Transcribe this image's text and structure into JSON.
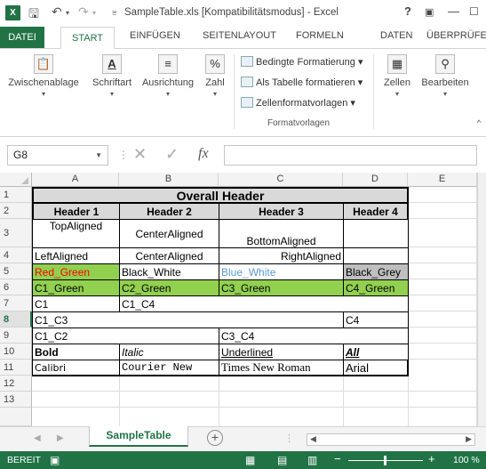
{
  "titlebar": {
    "app_icon": "X",
    "title": "SampleTable.xls [Kompatibilitätsmodus] - Excel",
    "help": "?"
  },
  "tabs": [
    "DATEI",
    "START",
    "EINFÜGEN",
    "SEITENLAYOUT",
    "FORMELN",
    "DATEN",
    "ÜBERPRÜFEN"
  ],
  "active_tab": "START",
  "ribbon": {
    "clipboard": "Zwischenablage",
    "font": "Schriftart",
    "alignment": "Ausrichtung",
    "number": "Zahl",
    "cond_format": "Bedingte Formatierung ▾",
    "table_format": "Als Tabelle formatieren ▾",
    "cell_styles": "Zellenformatvorlagen ▾",
    "styles_group": "Formatvorlagen",
    "cells": "Zellen",
    "editing": "Bearbeiten"
  },
  "formula_bar": {
    "name_box": "G8",
    "fx": "fx",
    "value": ""
  },
  "columns": [
    "A",
    "B",
    "C",
    "D",
    "E"
  ],
  "rows": [
    "1",
    "2",
    "3",
    "4",
    "5",
    "6",
    "7",
    "8",
    "9",
    "10",
    "11",
    "12",
    "13"
  ],
  "selected_row": "8",
  "cells": {
    "overall_header": "Overall Header",
    "h1": "Header 1",
    "h2": "Header 2",
    "h3": "Header 3",
    "h4": "Header 4",
    "top_aligned": "TopAligned",
    "center_aligned_r3": "CenterAligned",
    "bottom_aligned": "BottomAligned",
    "left_aligned": "LeftAligned",
    "center_aligned_r4": "CenterAligned",
    "right_aligned": "RightAligned",
    "red_green": "Red_Green",
    "black_white": "Black_White",
    "blue_white": "Blue_White",
    "black_grey": "Black_Grey",
    "c1_green": "C1_Green",
    "c2_green": "C2_Green",
    "c3_green": "C3_Green",
    "c4_green": "C4_Green",
    "c1": "C1",
    "c1_c4": "C1_C4",
    "c1_c3": "C1_C3",
    "c4": "C4",
    "c1_c2": "C1_C2",
    "c3_c4": "C3_C4",
    "bold": "Bold",
    "italic": "Italic",
    "underlined": "Underlined",
    "all": "All",
    "calibri": "Calibri",
    "courier": "Courier New",
    "times": "Times New Roman",
    "arial": "Arial"
  },
  "colors": {
    "excel_green": "#217346",
    "fill_green": "#92d050",
    "fill_grey": "#bfbfbf",
    "red_text": "#ff0000",
    "blue_text": "#5b9bd5",
    "header_fill": "#d9d9d9"
  },
  "sheet_tab": "SampleTable",
  "add_sheet": "+",
  "status": {
    "mode": "BEREIT",
    "zoom": "100 %"
  }
}
